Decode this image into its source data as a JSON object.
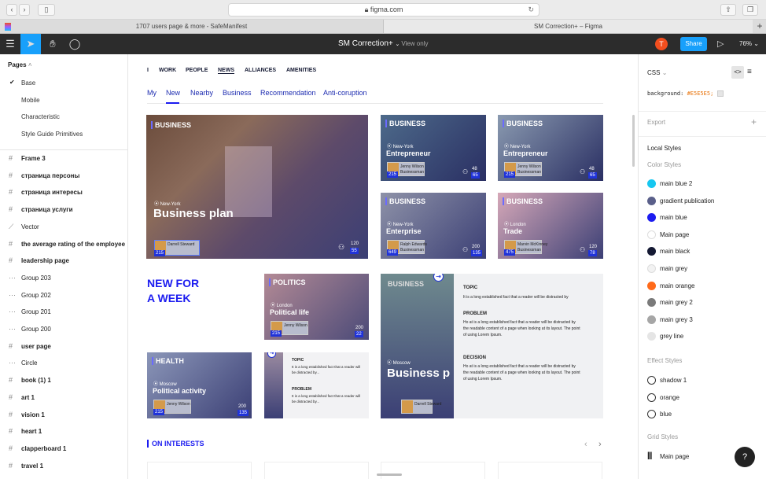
{
  "browser": {
    "url": "figma.com",
    "tabs": [
      "1707 users page & more - SafeManifest",
      "SM Correction+ – Figma"
    ]
  },
  "figma": {
    "file_name": "SM Correction+",
    "view_mode": "View only",
    "avatar_letter": "T",
    "share_label": "Share",
    "zoom": "76%"
  },
  "left_panel": {
    "pages_label": "Pages",
    "pages": [
      "Base",
      "Mobile",
      "Characteristic",
      "Style Guide Primitives"
    ],
    "layers": [
      {
        "icon": "#",
        "name": "Frame 3"
      },
      {
        "icon": "#",
        "name": "страница персоны"
      },
      {
        "icon": "#",
        "name": "страница интересы"
      },
      {
        "icon": "#",
        "name": "страница услуги"
      },
      {
        "icon": "⟋",
        "name": "Vector"
      },
      {
        "icon": "#",
        "name": "the average rating of the employee"
      },
      {
        "icon": "#",
        "name": "leadership page"
      },
      {
        "icon": "⋯",
        "name": "Group 203"
      },
      {
        "icon": "⋯",
        "name": "Group 202"
      },
      {
        "icon": "⋯",
        "name": "Group 201"
      },
      {
        "icon": "⋯",
        "name": "Group 200"
      },
      {
        "icon": "#",
        "name": "user page"
      },
      {
        "icon": "⋯",
        "name": "Circle"
      },
      {
        "icon": "#",
        "name": "book (1) 1"
      },
      {
        "icon": "#",
        "name": "art 1"
      },
      {
        "icon": "#",
        "name": "vision 1"
      },
      {
        "icon": "#",
        "name": "heart 1"
      },
      {
        "icon": "#",
        "name": "clapperboard 1"
      },
      {
        "icon": "#",
        "name": "travel 1"
      }
    ]
  },
  "canvas": {
    "top_nav": [
      "I",
      "WORK",
      "PEOPLE",
      "NEWS",
      "ALLIANCES",
      "AMENITIES"
    ],
    "sub_nav": [
      "My",
      "New",
      "Nearby",
      "Business",
      "Recommendation",
      "Anti-coruption"
    ],
    "new_for_week": [
      "NEW FOR",
      "A WEEK"
    ],
    "on_interests": "ON INTERESTS",
    "cards": {
      "big": {
        "tag": "BUSINESS",
        "city": "New-York",
        "title": "Business plan",
        "person": "Darrell Steward",
        "n1": "215",
        "n2": "120",
        "n3": "55"
      },
      "c1": {
        "tag": "BUSINESS",
        "city": "New-York",
        "title": "Entrepreneur",
        "person": "Jenny Wilson",
        "role": "Businessman",
        "n1": "215",
        "n2": "48",
        "n3": "65"
      },
      "c2": {
        "tag": "BUSINESS",
        "city": "New-York",
        "title": "Entrepreneur",
        "person": "Jenny Wilson",
        "role": "Businessman",
        "n1": "215",
        "n2": "48",
        "n3": "65"
      },
      "c3": {
        "tag": "BUSINESS",
        "city": "New-York",
        "title": "Enterprise",
        "person": "Ralph Edwards",
        "role": "Businessman",
        "n1": "649",
        "n2": "200",
        "n3": "135"
      },
      "c4": {
        "tag": "BUSINESS",
        "city": "London",
        "title": "Trade",
        "person": "Marvin McKinney",
        "role": "Businessman",
        "n1": "475",
        "n2": "120",
        "n3": "78"
      },
      "politics": {
        "tag": "POLITICS",
        "city": "London",
        "title": "Political life",
        "person": "Jenny Wilson",
        "role": "Businessman",
        "n1": "215",
        "n2": "200",
        "n3": "22"
      },
      "health": {
        "tag": "HEALTH",
        "city": "Moscow",
        "title": "Political activity",
        "person": "Jenny Wilson",
        "role": "Businessman",
        "n1": "215",
        "n2": "200",
        "n3": "135"
      },
      "wide": {
        "tag": "BUSINESS",
        "city": "Moscow",
        "title": "Business p",
        "person": "Darrell Steward"
      }
    },
    "topic_label": "TOPIC",
    "problem_label": "PROBLEM",
    "decision_label": "DECISION",
    "topic_text": "It is a long established fact that a reader will be distracted by",
    "problem_text": "Ho at is a long established fact that a reader will be distracted by the readable content of a page when looking at its layout. The point of using Lorem Ipsum.",
    "decision_text": "Ho at is a long established fact that a reader will be distracted by the readable content of a page when looking at its layout. The point of using Lorem Ipsum.",
    "small_topic_text": "It is a long established fact that a reader will be distracted by...",
    "small_problem_text": "It is a long established fact that a reader will be distracted by..."
  },
  "right_panel": {
    "css_label": "CSS",
    "css_prop": "background:",
    "css_value": "#E5E5E5;",
    "export_label": "Export",
    "local_styles": "Local Styles",
    "color_styles": "Color Styles",
    "colors": [
      {
        "name": "main blue 2",
        "color": "#17c7f0"
      },
      {
        "name": "gradient publication",
        "color": "#5a5f8a"
      },
      {
        "name": "main blue",
        "color": "#1c1cf0"
      },
      {
        "name": "Main page",
        "color": "#ffffff"
      },
      {
        "name": "main black",
        "color": "#141933"
      },
      {
        "name": "main grey",
        "color": "#f2f2f2"
      },
      {
        "name": "main orange",
        "color": "#ff6a1a"
      },
      {
        "name": "main grey 2",
        "color": "#7a7a7a"
      },
      {
        "name": "main grey 3",
        "color": "#a6a6a6"
      },
      {
        "name": "grey line",
        "color": "#e5e5e5"
      }
    ],
    "effect_styles": "Effect Styles",
    "effects": [
      "shadow 1",
      "orange",
      "blue"
    ],
    "grid_styles": "Grid Styles",
    "grids": [
      "Main page"
    ],
    "help": "?"
  }
}
